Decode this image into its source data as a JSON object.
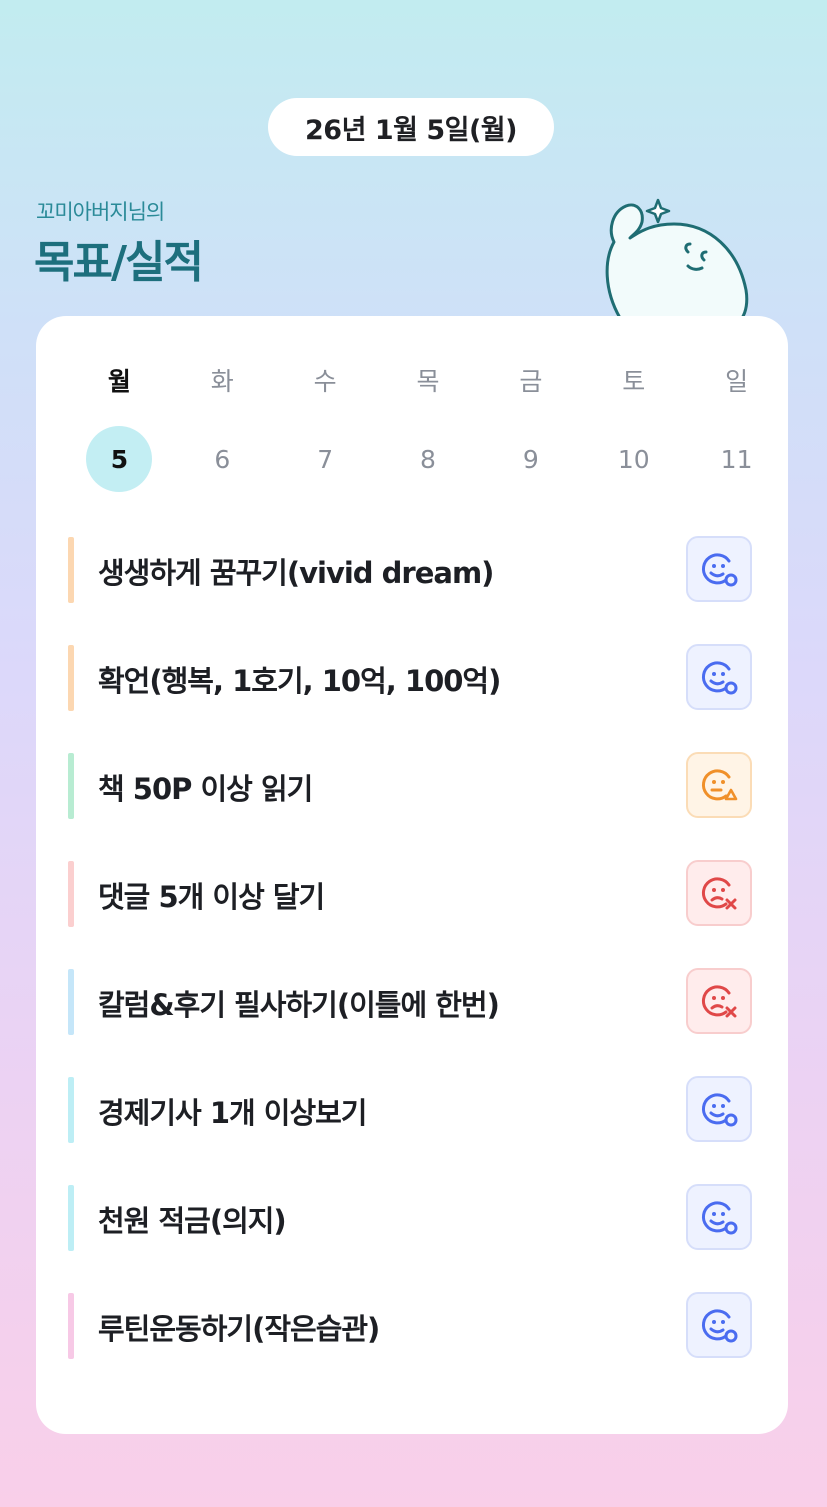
{
  "header": {
    "date": "26년 1월 5일(월)",
    "owner": "꼬미아버지님의",
    "title": "목표/실적"
  },
  "week": {
    "days": [
      {
        "name": "월",
        "date": "5",
        "selected": true
      },
      {
        "name": "화",
        "date": "6",
        "selected": false
      },
      {
        "name": "수",
        "date": "7",
        "selected": false
      },
      {
        "name": "목",
        "date": "8",
        "selected": false
      },
      {
        "name": "금",
        "date": "9",
        "selected": false
      },
      {
        "name": "토",
        "date": "10",
        "selected": false
      },
      {
        "name": "일",
        "date": "11",
        "selected": false
      }
    ]
  },
  "goals": [
    {
      "label": "생생하게 꿈꾸기(vivid dream)",
      "bar_color": "#fcd7b1",
      "status": "done",
      "icon": "smile-check-icon"
    },
    {
      "label": "확언(행복, 1호기, 10억, 100억)",
      "bar_color": "#fcd7b1",
      "status": "done",
      "icon": "smile-check-icon"
    },
    {
      "label": "책 50P 이상 읽기",
      "bar_color": "#b8ecd2",
      "status": "partial",
      "icon": "neutral-warning-icon"
    },
    {
      "label": "댓글 5개 이상 달기",
      "bar_color": "#fbcfcf",
      "status": "fail",
      "icon": "sad-x-icon"
    },
    {
      "label": "칼럼&후기 필사하기(이틀에 한번)",
      "bar_color": "#c5e6f9",
      "status": "fail",
      "icon": "sad-x-icon"
    },
    {
      "label": "경제기사 1개 이상보기",
      "bar_color": "#bdeef5",
      "status": "done",
      "icon": "smile-check-icon"
    },
    {
      "label": "천원 적금(의지)",
      "bar_color": "#bdeef5",
      "status": "done",
      "icon": "smile-check-icon"
    },
    {
      "label": "루틴운동하기(작은습관)",
      "bar_color": "#f7c9e6",
      "status": "done",
      "icon": "smile-check-icon"
    }
  ],
  "status_colors": {
    "done": "#4a6cf0",
    "partial": "#f0902a",
    "fail": "#e04848"
  }
}
